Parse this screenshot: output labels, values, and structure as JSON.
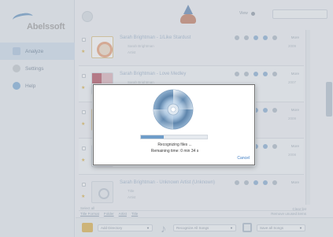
{
  "app": {
    "logo_text": "Abelssoft"
  },
  "sidebar": {
    "items": [
      {
        "label": "Analyze",
        "icon": "analyze-icon"
      },
      {
        "label": "Settings",
        "icon": "gear-icon"
      },
      {
        "label": "Help",
        "icon": "help-icon"
      }
    ]
  },
  "topbar": {
    "view_label": "View"
  },
  "tracks": [
    {
      "title": "Sarah Brightman - 1/Like Stardust",
      "meta": "Sarah Brightman",
      "meta2": "Artist",
      "album": "Every Time of the Ye...",
      "year": "2009",
      "rating": "10"
    },
    {
      "title": "Sarah Brightman - Love Medley",
      "meta": "Sarah Brightman",
      "meta2": "Artist",
      "album": "Dark Wings",
      "year": "2007",
      "rating": "5"
    },
    {
      "title": "Sarah Brightman",
      "meta": "Sarah Brightman",
      "meta2": "Artist",
      "album": "",
      "year": "2009",
      "rating": "5"
    },
    {
      "title": "Sarah Brightman",
      "meta": "Sarah Brightman",
      "meta2": "Artist",
      "album": "",
      "year": "2008",
      "rating": "10"
    },
    {
      "title": "Sarah Brightman - Unknown Artist (Unknown)",
      "meta": "Title",
      "meta2": "Artist",
      "album": "",
      "year": "",
      "rating": ""
    }
  ],
  "footer": {
    "select_all": "Select all",
    "links": [
      "Title Format",
      "Folder",
      "Artist",
      "Title"
    ],
    "right_line1": "Clear list",
    "right_line2": "Remove unused items"
  },
  "toolbar": {
    "select1": "Add Directory",
    "select2": "Recognize All Songs",
    "select3": "Save all Songs"
  },
  "dialog": {
    "status": "Recognizing files ...",
    "remaining": "Remaining time: 0 min 34 s",
    "cancel": "Cancel",
    "progress": 0.35
  },
  "colors": {
    "accent": "#3a7ac2",
    "progress": "#6e9cc9"
  }
}
